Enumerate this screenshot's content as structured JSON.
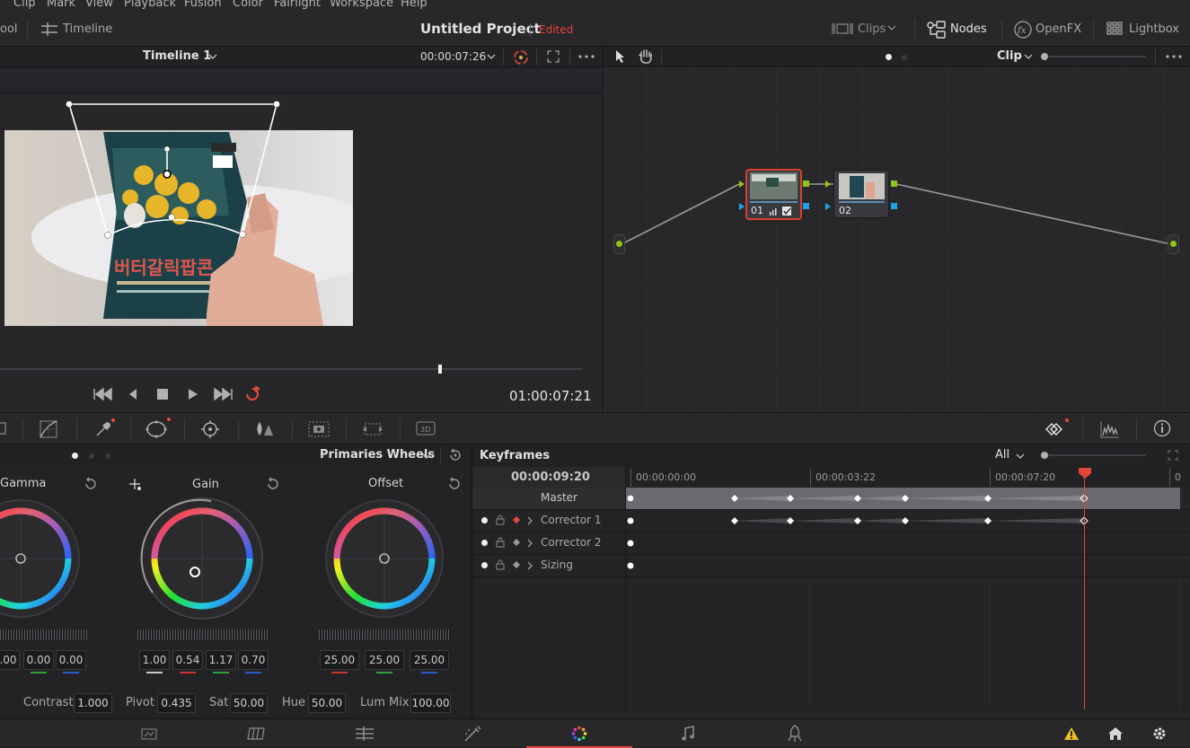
{
  "menu": [
    "Clip",
    "Mark",
    "View",
    "Playback",
    "Fusion",
    "Color",
    "Fairlight",
    "Workspace",
    "Help"
  ],
  "toolbar": {
    "left_partial": "ool",
    "timeline_label": "Timeline",
    "project_title": "Untitled Project",
    "project_status": "Edited",
    "clips_label": "Clips",
    "nodes_label": "Nodes",
    "openfx_label": "OpenFX",
    "lightbox_label": "Lightbox"
  },
  "viewer": {
    "timeline_name": "Timeline 1",
    "timecode_top": "00:00:07:26",
    "timecode_bottom": "01:00:07:21"
  },
  "node_editor": {
    "mode_label": "Clip",
    "nodes": [
      {
        "label": "01"
      },
      {
        "label": "02"
      }
    ]
  },
  "wheels": {
    "mode_label": "Primaries Wheels",
    "gamma": {
      "label": "Gamma",
      "values": [
        ".00",
        "0.00",
        "0.00"
      ]
    },
    "gain": {
      "label": "Gain",
      "values": [
        "1.00",
        "0.54",
        "1.17",
        "0.70"
      ]
    },
    "offset": {
      "label": "Offset",
      "values": [
        "25.00",
        "25.00",
        "25.00"
      ]
    },
    "bottom": {
      "contrast_label": "Contrast",
      "contrast": "1.000",
      "pivot_label": "Pivot",
      "pivot": "0.435",
      "sat_label": "Sat",
      "sat": "50.00",
      "hue_label": "Hue",
      "hue": "50.00",
      "lummix_label": "Lum Mix",
      "lummix": "100.00"
    }
  },
  "keyframes": {
    "title": "Keyframes",
    "filter": "All",
    "current_tc": "00:00:09:20",
    "ruler": [
      "00:00:00:00",
      "00:00:03:22",
      "00:00:07:20",
      "0"
    ],
    "tracks": [
      {
        "name": "Master"
      },
      {
        "name": "Corrector 1"
      },
      {
        "name": "Corrector 2"
      },
      {
        "name": "Sizing"
      }
    ]
  },
  "colors": {
    "accent_red": "#e64a3c",
    "edited": "#e0453a",
    "node_green": "#8fc41a",
    "node_blue": "#1fa3e8",
    "playhead": "#e0463a"
  }
}
